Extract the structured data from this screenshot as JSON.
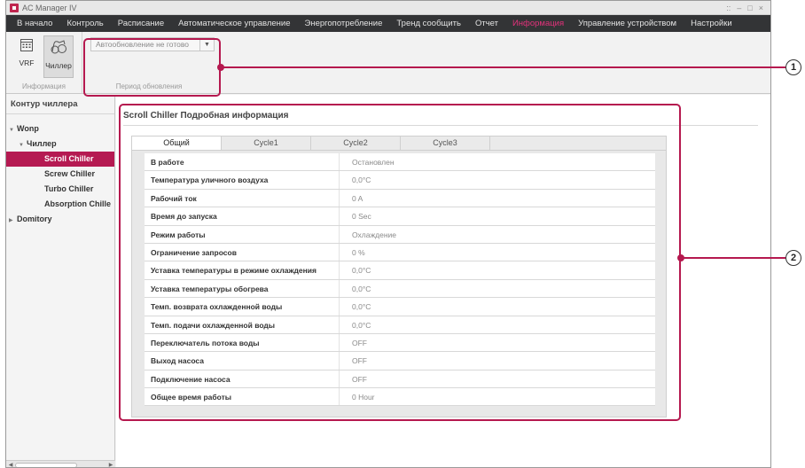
{
  "window": {
    "title": "AC Manager IV",
    "controls": [
      "::",
      "–",
      "□",
      "×"
    ]
  },
  "menu": {
    "items": [
      "В начало",
      "Контроль",
      "Расписание",
      "Автоматическое управление",
      "Энергопотребление",
      "Тренд сообщить",
      "Отчет",
      "Информация",
      "Управление устройством",
      "Настройки"
    ],
    "active": "Информация"
  },
  "ribbon": {
    "vrf_label": "VRF",
    "chiller_label": "Чиллер",
    "info_group_label": "Информация",
    "period_combo_value": "Автообновление не готово",
    "period_group_label": "Период обновления"
  },
  "sidebar": {
    "title": "Контур чиллера",
    "tree": {
      "root": "Wonp",
      "group": "Чиллер",
      "items": [
        "Scroll Chiller",
        "Screw Chiller",
        "Turbo Chiller",
        "Absorption Chille"
      ],
      "selected": "Scroll Chiller",
      "other": "Domitory"
    }
  },
  "content": {
    "title": "Scroll Chiller Подробная информация",
    "tabs": [
      "Общий",
      "Cycle1",
      "Cycle2",
      "Cycle3"
    ],
    "active_tab": "Общий",
    "rows": [
      {
        "label": "В работе",
        "value": "Остановлен"
      },
      {
        "label": "Температура уличного воздуха",
        "value": "0,0°C"
      },
      {
        "label": "Рабочий ток",
        "value": "0 A"
      },
      {
        "label": "Время до запуска",
        "value": "0 Sec"
      },
      {
        "label": "Режим работы",
        "value": "Охлаждение"
      },
      {
        "label": "Ограничение запросов",
        "value": "0 %"
      },
      {
        "label": "Уставка температуры в режиме охлаждения",
        "value": "0,0°C"
      },
      {
        "label": "Уставка температуры обогрева",
        "value": "0,0°C"
      },
      {
        "label": "Темп. возврата охлажденной воды",
        "value": "0,0°C"
      },
      {
        "label": "Темп. подачи охлажденной воды",
        "value": "0,0°C"
      },
      {
        "label": "Переключатель потока воды",
        "value": "OFF"
      },
      {
        "label": "Выход насоса",
        "value": "OFF"
      },
      {
        "label": "Подключение насоса",
        "value": "OFF"
      },
      {
        "label": "Общее время работы",
        "value": "0 Hour"
      }
    ]
  },
  "callouts": [
    "1",
    "2"
  ],
  "colors": {
    "accent": "#b51a52",
    "menu_active": "#e2327b",
    "menubar_bg": "#333436"
  }
}
